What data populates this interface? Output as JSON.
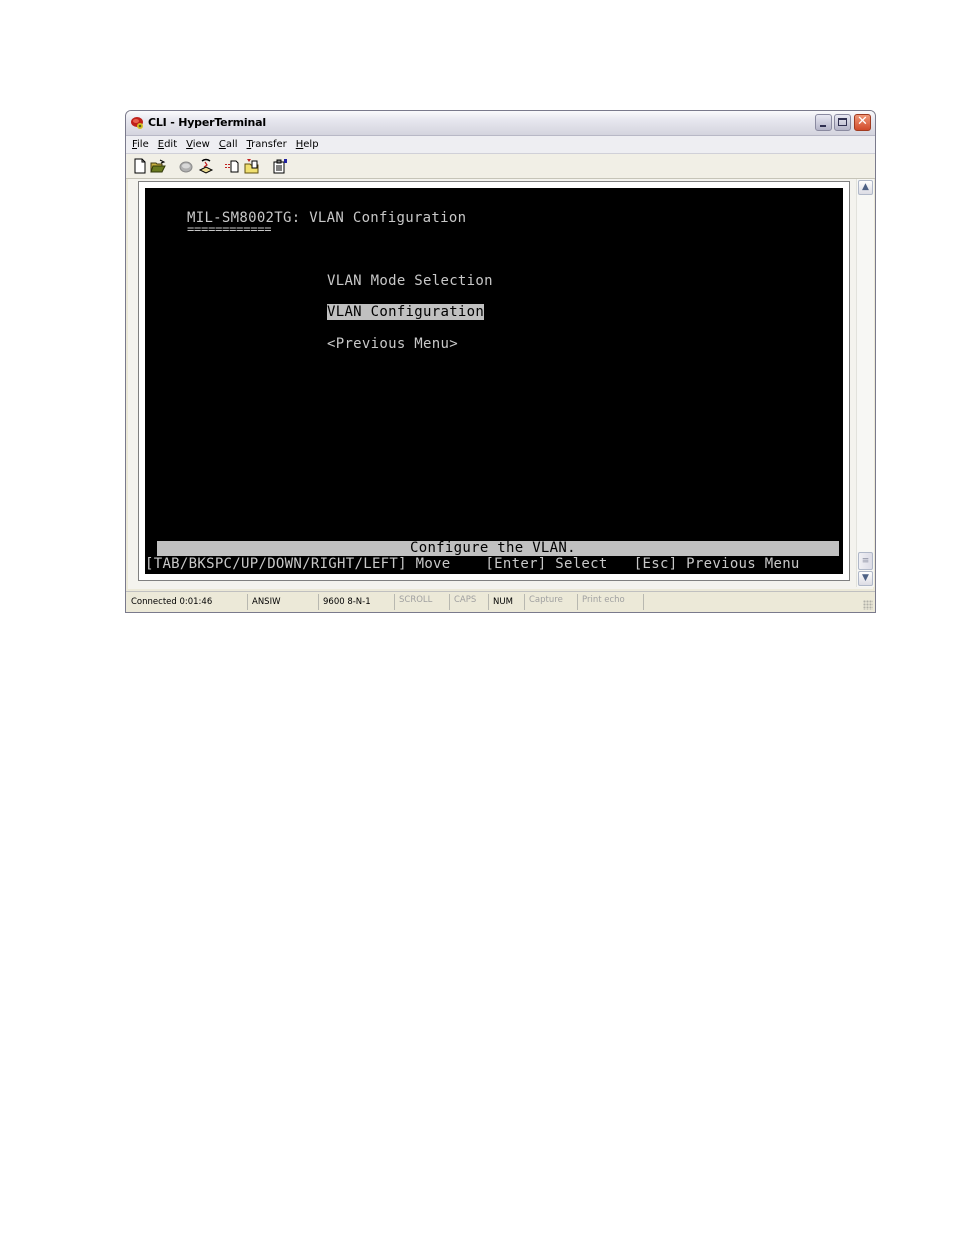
{
  "window": {
    "title": "CLI - HyperTerminal",
    "app_icon": "hyperterminal-phone-icon",
    "controls": {
      "minimize": "minimize",
      "maximize": "maximize",
      "close": "close"
    }
  },
  "menubar": {
    "items": [
      {
        "key": "F",
        "rest": "ile"
      },
      {
        "key": "E",
        "rest": "dit"
      },
      {
        "key": "V",
        "rest": "iew"
      },
      {
        "key": "C",
        "rest": "all"
      },
      {
        "key": "T",
        "rest": "ransfer"
      },
      {
        "key": "H",
        "rest": "elp"
      }
    ]
  },
  "toolbar": {
    "icons": [
      "new-icon",
      "open-icon",
      "connect-icon",
      "disconnect-icon",
      "send-icon",
      "receive-icon",
      "properties-icon"
    ]
  },
  "terminal": {
    "header": "MIL-SM8002TG: VLAN Configuration",
    "underline": "============",
    "menu_items": [
      {
        "label": "VLAN Mode Selection",
        "selected": false
      },
      {
        "label": "VLAN Configuration",
        "selected": true
      },
      {
        "label": "<Previous Menu>",
        "selected": false
      }
    ],
    "status_message": "Configure the VLAN.",
    "help_line": "[TAB/BKSPC/UP/DOWN/RIGHT/LEFT] Move    [Enter] Select   [Esc] Previous Menu",
    "colors": {
      "background": "#000000",
      "text": "#c8c8c8",
      "highlight": "#c0c0c0"
    }
  },
  "statusbar": {
    "connected": "Connected 0:01:46",
    "emulation": "ANSIW",
    "port_settings": "9600 8-N-1",
    "scroll": "SCROLL",
    "caps": "CAPS",
    "num": "NUM",
    "capture": "Capture",
    "print_echo": "Print echo"
  }
}
